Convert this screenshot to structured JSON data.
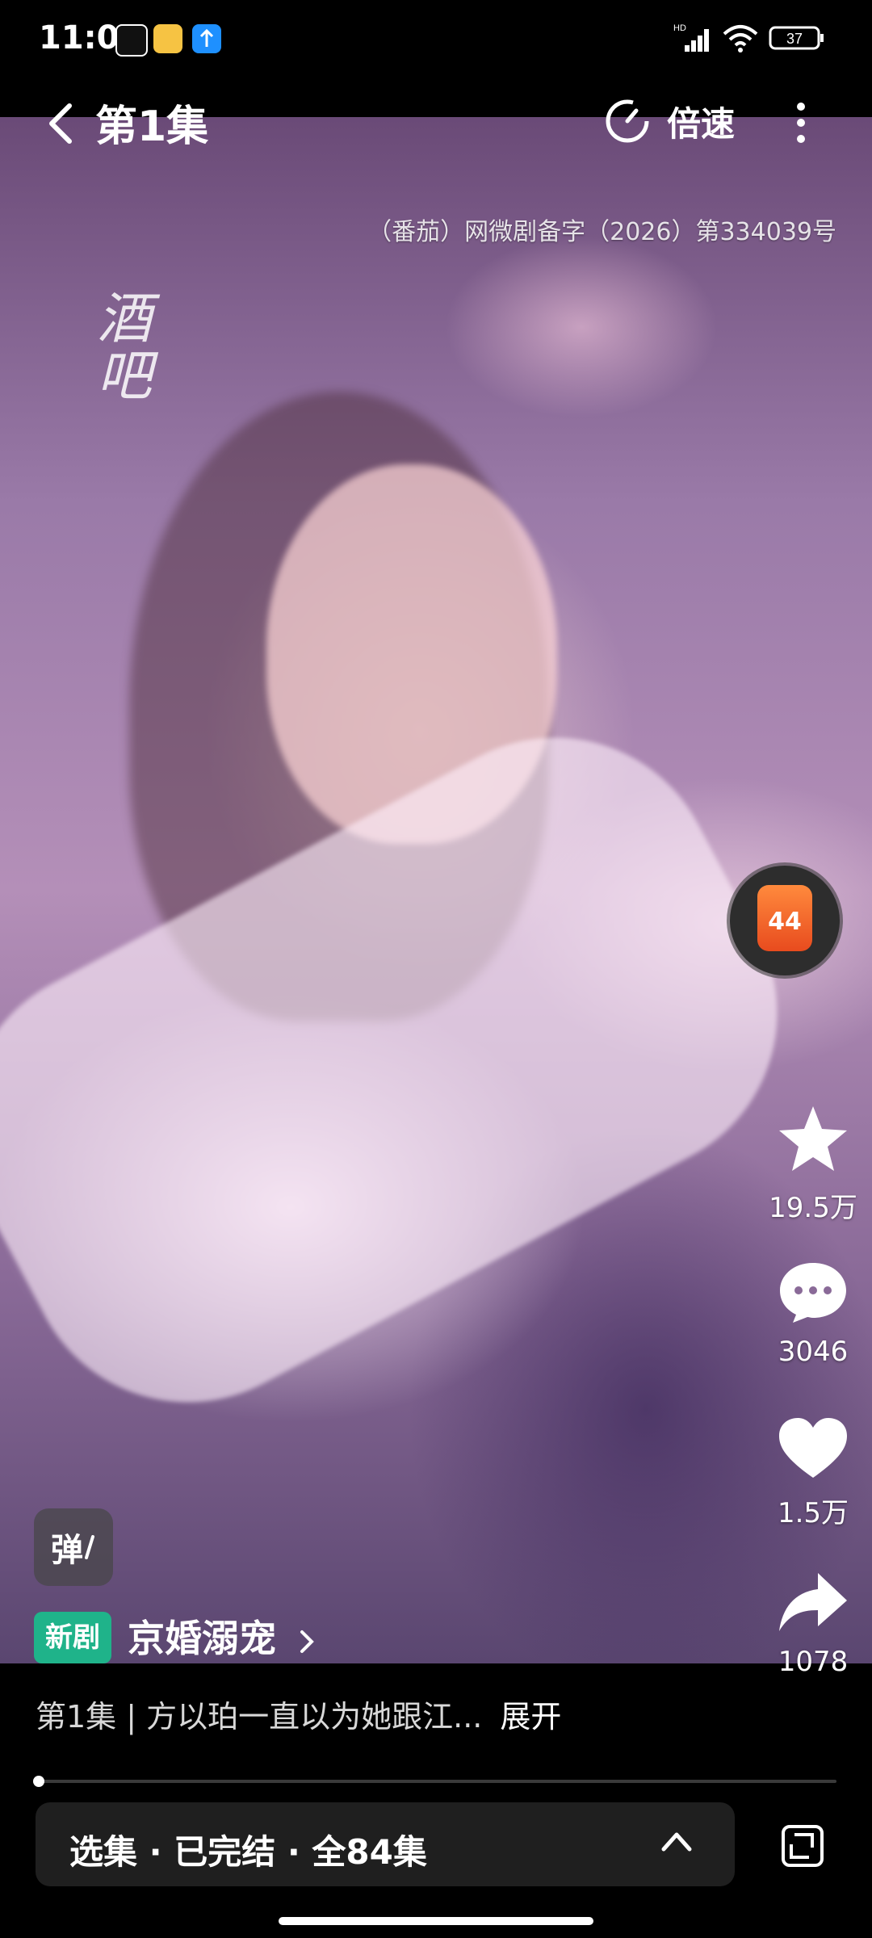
{
  "status_bar": {
    "time": "11:00",
    "battery": "37",
    "network": "HD"
  },
  "top_bar": {
    "episode_title": "第1集",
    "speed_label": "倍速"
  },
  "video": {
    "license_text": "（番茄）网微剧备字（2026）第334039号",
    "watermark_line1": "酒",
    "watermark_line2": "吧"
  },
  "gift": {
    "number": "44"
  },
  "actions": {
    "favorite_count": "19.5万",
    "comment_count": "3046",
    "like_count": "1.5万",
    "share_count": "1078"
  },
  "danmu_label": "弹",
  "drama": {
    "badge": "新剧",
    "name": "京婚溺宠"
  },
  "description": {
    "text": "第1集 | 方以珀一直以为她跟江...",
    "expand": "展开"
  },
  "progress": {
    "fraction": 0.004
  },
  "episodes_bar": {
    "text": "选集 · 已完结 · 全84集"
  },
  "colors": {
    "badge": "#1fb38a",
    "gift": "#e84b1e",
    "background": "#000000"
  }
}
